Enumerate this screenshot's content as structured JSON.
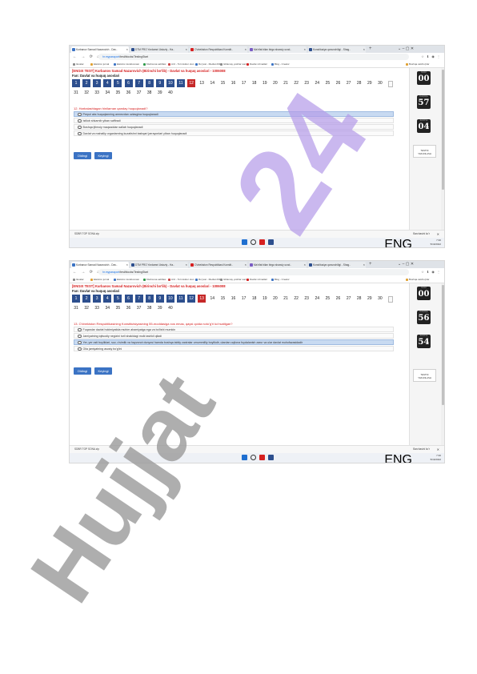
{
  "screens": [
    {
      "tabs": [
        "Kurbanov Samad Nazarovich - Dav..",
        "DTM PRO Yordamni Ustoziy - Ha..",
        "O'zbekiston Respublikasi Konstit..",
        "Ma'rifat bilan birga shaxsiy ozod..",
        "Konstitusiya qonunchiligi - Shag.."
      ],
      "url_host": "hr.mypassport",
      "url_path": "/test/blocks/TestingStart",
      "bookmarks": [
        "Ilovalar",
        "Elektron jurnal",
        "Elektron kutubxonasi",
        "Kitobxona sahifasi",
        "Ariz - Tort doktor olun",
        "Ro'yxat - Mediat 2019",
        "Ishlamay yoshlar soni",
        "Davlat xizmatlari",
        "Blog - Creator",
        "Boshqa xatcho'plar"
      ],
      "test_title": "[ENGIX TEST]   Kurbanov Samad Nazarovich (Birinchi bo'lib) - Davlat va huquq asoslari - 1006008",
      "subject": "Fan:  Davlat va huquq asoslari",
      "questions_row1": [
        "1",
        "2",
        "3",
        "4",
        "5",
        "6",
        "7",
        "8",
        "9",
        "10",
        "11",
        "12",
        "13",
        "14",
        "15",
        "16",
        "17",
        "18",
        "19",
        "20",
        "21",
        "22",
        "23",
        "24",
        "25",
        "26",
        "27",
        "28",
        "29",
        "30"
      ],
      "questions_row2": [
        "31",
        "32",
        "33",
        "34",
        "35",
        "36",
        "37",
        "38",
        "39",
        "40"
      ],
      "answered_count": 11,
      "current": "12",
      "question": "12.  Harbalashlagan hinilarnan qanday huquqlanadi?",
      "options": [
        "Prepol aks huquqlanning amnezdan uzlasgina huquqlanadi",
        "Istilob shkarnib yiban saffiradi",
        "Boshqa ijtimoiy maqsaddan sallab huquqlanadi",
        "Davlat va mahalliy organlarning kuzatishni tashqari jarrayonlari yiban huquqlanadi"
      ],
      "selected_option": 0,
      "btn_prev": "Oldingi",
      "btn_next": "Keyingi",
      "clock_caption": [
        "SOAT",
        "DAQIQA",
        "SONIYA"
      ],
      "clock": [
        "00",
        "57",
        "04"
      ],
      "finish_label": [
        "TESTNI",
        "YAKUNLASH"
      ],
      "download_file": "SDBR TOP SONA.zip",
      "download_all": "Barchasini ko'r",
      "tray_lang": [
        "ENG",
        "US"
      ],
      "tray_time": "7:30",
      "tray_date": "5/19/2022"
    },
    {
      "tabs": [
        "Kurbanov Samad Nazarovich - Dav..",
        "DTM PRO Yordamni Ustoziy - Ha..",
        "O'zbekiston Respublikasi Konstit..",
        "Ma'rifat bilan birga shaxsiy ozod..",
        "Konstitusiya qonunchiligi - Shag.."
      ],
      "url_host": "hr.mypassport",
      "url_path": "/test/blocks/TestingStart",
      "bookmarks": [
        "Ilovalar",
        "Elektron jurnal",
        "Elektron kutubxonasi",
        "Kitobxona sahifasi",
        "Ariz - Tort doktor olun",
        "Ro'yxat - Mediat 2019",
        "Ishlamay yoshlar soni",
        "Davlat xizmatlari",
        "Blog - Creator",
        "Boshqa xatcho'plar"
      ],
      "test_title": "[ENGIX TEST]   Kurbanov Samad Nazarovich (Birinchi bo'lib) - Davlat va huquq asoslari - 1006008",
      "subject": "Fan:  Davlat va huquq asoslari",
      "questions_row1": [
        "1",
        "2",
        "3",
        "4",
        "5",
        "6",
        "7",
        "8",
        "9",
        "10",
        "11",
        "12",
        "13",
        "14",
        "15",
        "16",
        "17",
        "18",
        "19",
        "20",
        "21",
        "22",
        "23",
        "24",
        "25",
        "26",
        "27",
        "28",
        "29",
        "30"
      ],
      "questions_row2": [
        "31",
        "32",
        "33",
        "34",
        "35",
        "36",
        "37",
        "38",
        "39",
        "40"
      ],
      "answered_count": 12,
      "current": "13",
      "question": "13.  O'zbekiston Respublikasining Konstitutsiyasining 55-moddasiga xos emas, qaysi qoida noto'g'ri ko'rsatilgan?",
      "options": [
        "Fuqarolar davlat hokimiyatida muhim ahamiyatga ega va bo'lishi mumkin",
        "Jamiyatning iqtisodiy negizini turli shakldagi mulk tashkil qiladi",
        "Yer, yer osti boyliklari, suv, o'simlik va hayvonot dunyosi hamda boshqa tabiiy zaxiralar umummilliy boylikdir, ulardan oqilona foydalanish zarur va ular davlat muhofazasidadir",
        "Oila jamiyatning asosiy bo'g'ini"
      ],
      "selected_option": 2,
      "btn_prev": "Oldingi",
      "btn_next": "Keyingi",
      "clock_caption": [
        "SOAT",
        "DAQIQA",
        "SONIYA"
      ],
      "clock": [
        "00",
        "56",
        "54"
      ],
      "finish_label": [
        "TESTNI",
        "YAKUNLASH"
      ],
      "download_file": "SDBR TOP SONA.zip",
      "download_all": "Barchasini ko'r",
      "tray_lang": [
        "ENG",
        "US"
      ],
      "tray_time": "7:30",
      "tray_date": "5/19/2022"
    }
  ],
  "watermark": {
    "text_main": "Hujjat",
    "text_number": "24",
    "color_main": "#9a9a9a",
    "color_number": "#b39ae8"
  },
  "colors": {
    "answered": "#2d4f8e",
    "current": "#c62828",
    "accent": "#3b73c4"
  }
}
